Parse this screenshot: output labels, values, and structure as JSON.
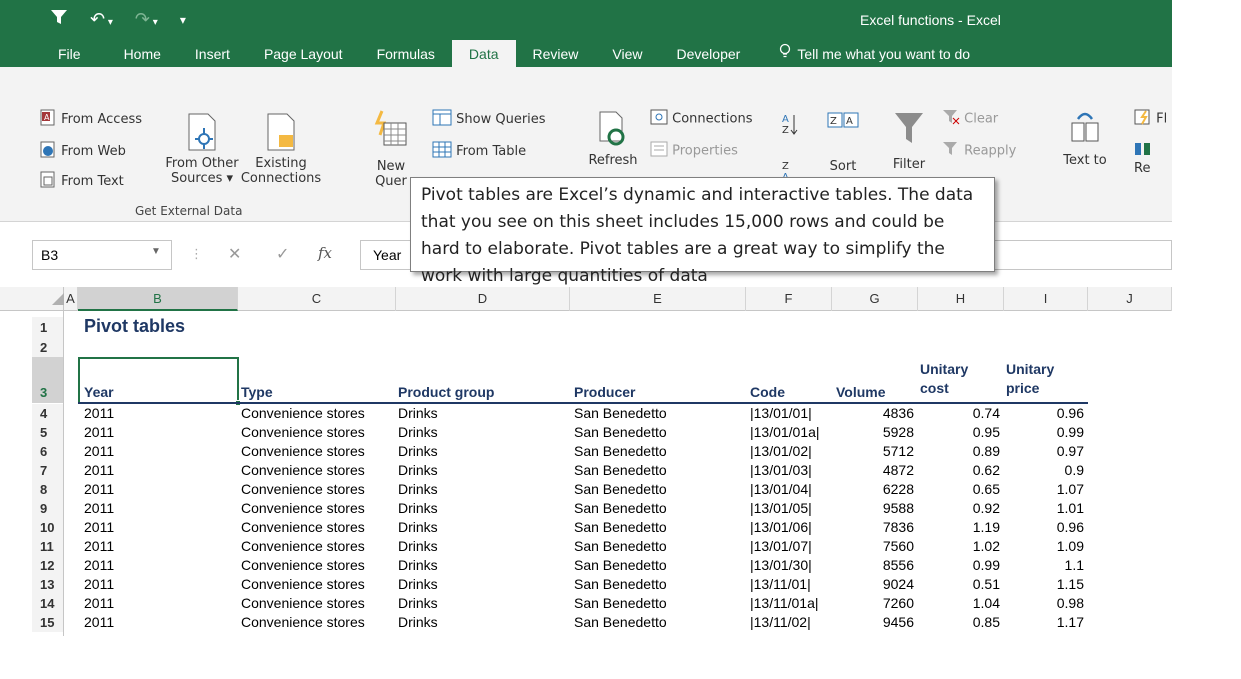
{
  "window": {
    "title": "Excel functions - Excel"
  },
  "quick_access": {
    "icons": [
      "filter-icon",
      "undo-icon",
      "redo-icon",
      "customize-icon"
    ]
  },
  "tabs": [
    {
      "label": "File"
    },
    {
      "label": "Home"
    },
    {
      "label": "Insert"
    },
    {
      "label": "Page Layout"
    },
    {
      "label": "Formulas"
    },
    {
      "label": "Data",
      "active": true
    },
    {
      "label": "Review"
    },
    {
      "label": "View"
    },
    {
      "label": "Developer"
    }
  ],
  "tell_me": "Tell me what you want to do",
  "ribbon": {
    "from_access": "From Access",
    "from_web": "From Web",
    "from_text": "From Text",
    "from_other_1": "From Other",
    "from_other_2": "Sources ▾",
    "existing_1": "Existing",
    "existing_2": "Connections",
    "get_external_data": "Get External Data",
    "new_query_1": "New",
    "new_query_2": "Quer",
    "show_queries": "Show Queries",
    "from_table": "From Table",
    "refresh": "Refresh",
    "connections": "Connections",
    "properties": "Properties",
    "sort": "Sort",
    "filter": "Filter",
    "clear": "Clear",
    "reapply": "Reapply",
    "text_to_1": "Text to",
    "flash_fill": "Fl",
    "remove_dup": "Re"
  },
  "formula_bar": {
    "name_box": "B3",
    "content": "Year"
  },
  "callout": {
    "text": "Pivot tables are Excel’s dynamic and interactive tables. The data that you see on this sheet includes 15,000 rows and could be hard to elaborate. Pivot tables are a great way to simplify the work with large quantities of data"
  },
  "columns": [
    "A",
    "B",
    "C",
    "D",
    "E",
    "F",
    "G",
    "H",
    "I",
    "J"
  ],
  "sheet": {
    "title": "Pivot tables",
    "headers": {
      "year": "Year",
      "type": "Type",
      "product_group": "Product group",
      "producer": "Producer",
      "code": "Code",
      "volume": "Volume",
      "unitary_cost_1": "Unitary",
      "unitary_cost_2": "cost",
      "unitary_price_1": "Unitary",
      "unitary_price_2": "price"
    },
    "row_numbers": [
      "1",
      "2",
      "3",
      "4",
      "5",
      "6",
      "7",
      "8",
      "9",
      "10",
      "11",
      "12",
      "13",
      "14",
      "15"
    ],
    "rows": [
      {
        "year": "2011",
        "type": "Convenience stores",
        "group": "Drinks",
        "producer": "San Benedetto",
        "code": "|13/01/01|",
        "volume": "4836",
        "cost": "0.74",
        "price": "0.96"
      },
      {
        "year": "2011",
        "type": "Convenience stores",
        "group": "Drinks",
        "producer": "San Benedetto",
        "code": "|13/01/01a|",
        "volume": "5928",
        "cost": "0.95",
        "price": "0.99"
      },
      {
        "year": "2011",
        "type": "Convenience stores",
        "group": "Drinks",
        "producer": "San Benedetto",
        "code": "|13/01/02|",
        "volume": "5712",
        "cost": "0.89",
        "price": "0.97"
      },
      {
        "year": "2011",
        "type": "Convenience stores",
        "group": "Drinks",
        "producer": "San Benedetto",
        "code": "|13/01/03|",
        "volume": "4872",
        "cost": "0.62",
        "price": "0.9"
      },
      {
        "year": "2011",
        "type": "Convenience stores",
        "group": "Drinks",
        "producer": "San Benedetto",
        "code": "|13/01/04|",
        "volume": "6228",
        "cost": "0.65",
        "price": "1.07"
      },
      {
        "year": "2011",
        "type": "Convenience stores",
        "group": "Drinks",
        "producer": "San Benedetto",
        "code": "|13/01/05|",
        "volume": "9588",
        "cost": "0.92",
        "price": "1.01"
      },
      {
        "year": "2011",
        "type": "Convenience stores",
        "group": "Drinks",
        "producer": "San Benedetto",
        "code": "|13/01/06|",
        "volume": "7836",
        "cost": "1.19",
        "price": "0.96"
      },
      {
        "year": "2011",
        "type": "Convenience stores",
        "group": "Drinks",
        "producer": "San Benedetto",
        "code": "|13/01/07|",
        "volume": "7560",
        "cost": "1.02",
        "price": "1.09"
      },
      {
        "year": "2011",
        "type": "Convenience stores",
        "group": "Drinks",
        "producer": "San Benedetto",
        "code": "|13/01/30|",
        "volume": "8556",
        "cost": "0.99",
        "price": "1.1"
      },
      {
        "year": "2011",
        "type": "Convenience stores",
        "group": "Drinks",
        "producer": "San Benedetto",
        "code": "|13/11/01|",
        "volume": "9024",
        "cost": "0.51",
        "price": "1.15"
      },
      {
        "year": "2011",
        "type": "Convenience stores",
        "group": "Drinks",
        "producer": "San Benedetto",
        "code": "|13/11/01a|",
        "volume": "7260",
        "cost": "1.04",
        "price": "0.98"
      },
      {
        "year": "2011",
        "type": "Convenience stores",
        "group": "Drinks",
        "producer": "San Benedetto",
        "code": "|13/11/02|",
        "volume": "9456",
        "cost": "0.85",
        "price": "1.17"
      }
    ]
  },
  "colors": {
    "excel_green": "#217346",
    "header_text": "#1f3864"
  }
}
